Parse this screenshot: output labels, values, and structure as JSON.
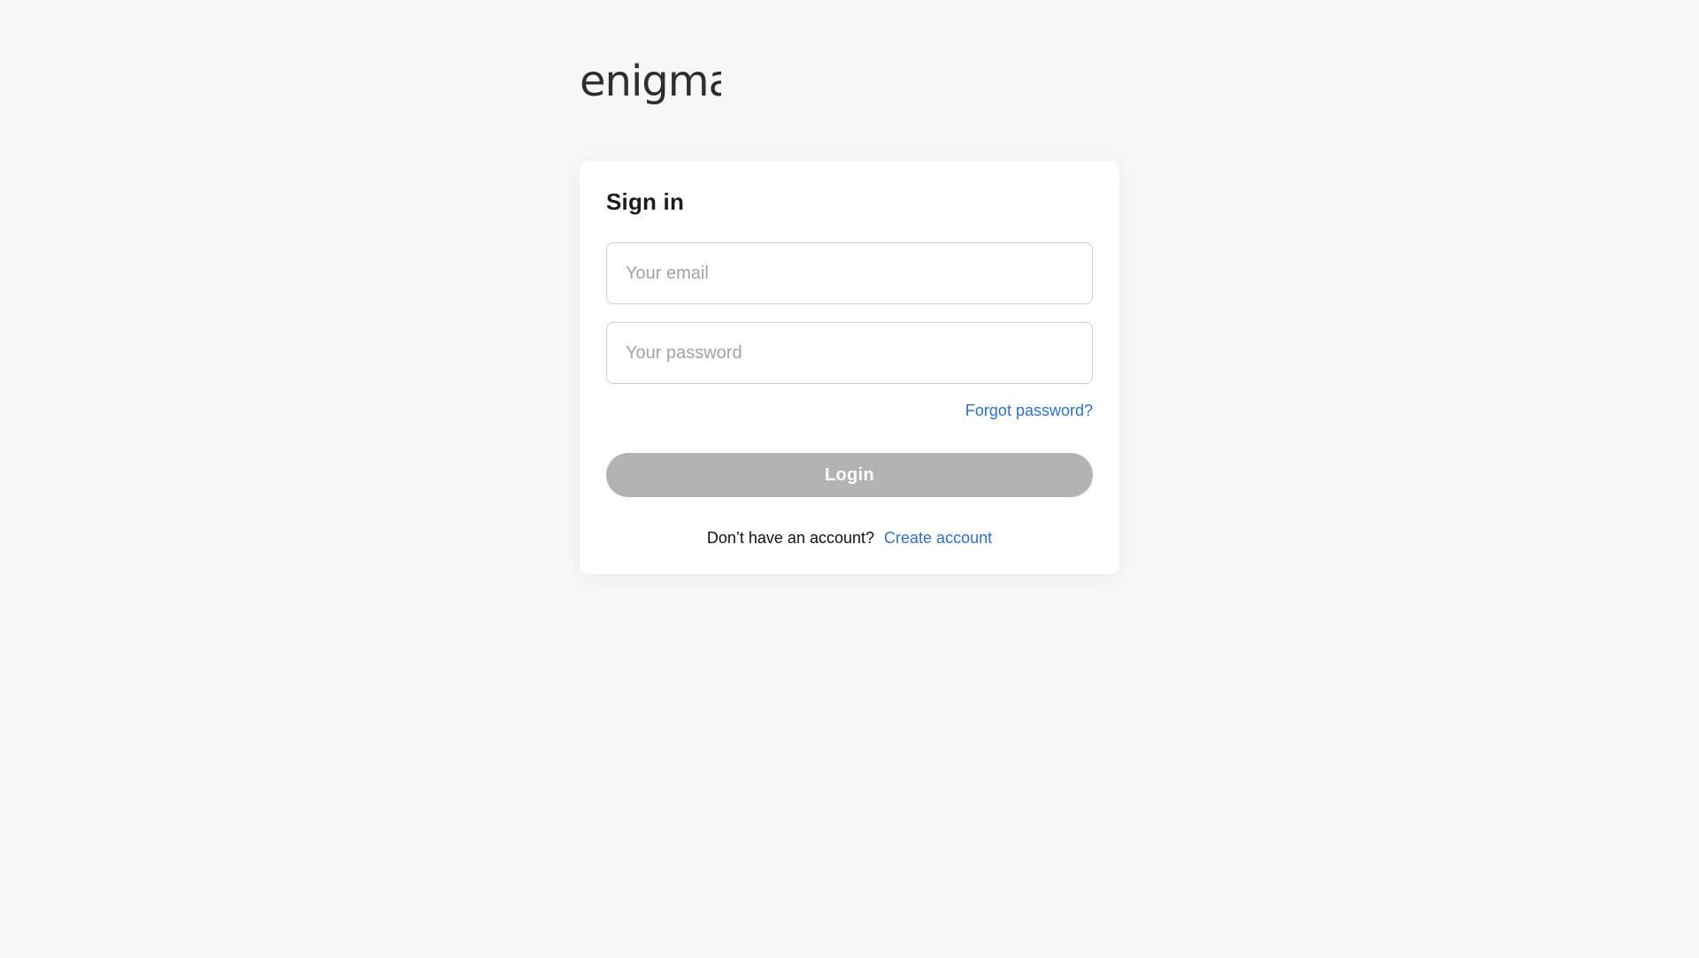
{
  "brand": {
    "logo_text": "enigma",
    "logo_color": "#2e2e2e"
  },
  "signin": {
    "title": "Sign in",
    "email_placeholder": "Your email",
    "email_value": "",
    "password_placeholder": "Your password",
    "password_value": "",
    "forgot_label": "Forgot password?",
    "login_label": "Login",
    "no_account_text": "Don’t have an account?",
    "create_account_label": "Create account"
  },
  "colors": {
    "background": "#f7f7f7",
    "card": "#ffffff",
    "link": "#2f6fc6",
    "button_disabled": "#b3b3b3",
    "input_border": "#cfcfcf"
  }
}
